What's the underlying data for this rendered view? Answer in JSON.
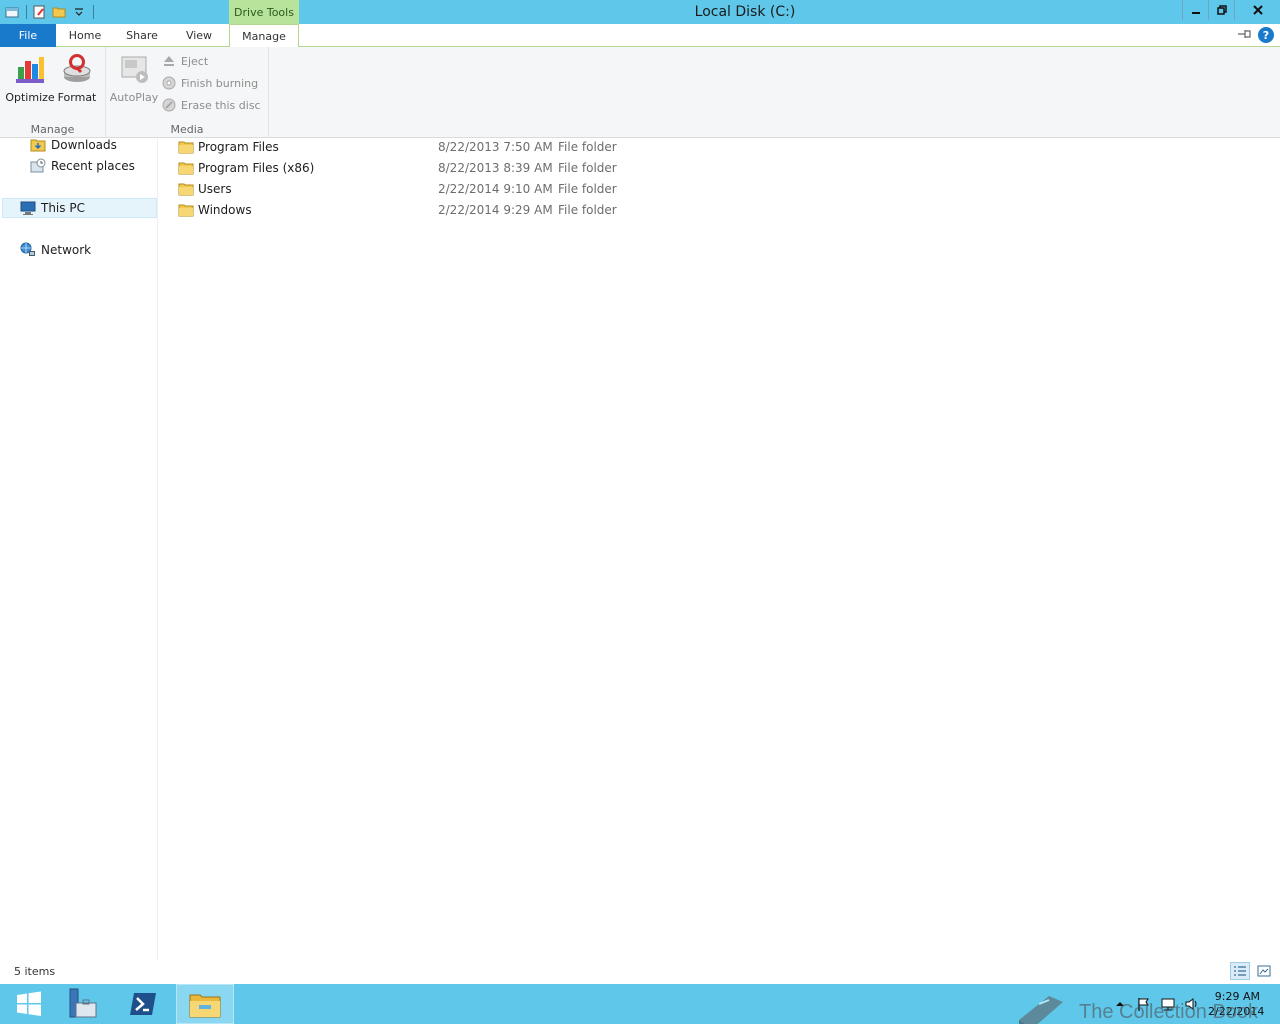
{
  "window": {
    "title": "Local Disk (C:)",
    "context_tab_label": "Drive Tools"
  },
  "tabs": {
    "file": "File",
    "home": "Home",
    "share": "Share",
    "view": "View",
    "manage": "Manage"
  },
  "ribbon": {
    "manage_group": {
      "label": "Manage",
      "optimize": "Optimize",
      "format": "Format"
    },
    "media_group": {
      "label": "Media",
      "autoplay": "AutoPlay",
      "eject": "Eject",
      "finish_burning": "Finish burning",
      "erase_disc": "Erase this disc"
    },
    "help": "?"
  },
  "nav": {
    "downloads": "Downloads",
    "recent_places": "Recent places",
    "this_pc": "This PC",
    "network": "Network"
  },
  "files": [
    {
      "name": "Program Files",
      "date": "8/22/2013 7:50 AM",
      "type": "File folder"
    },
    {
      "name": "Program Files (x86)",
      "date": "8/22/2013 8:39 AM",
      "type": "File folder"
    },
    {
      "name": "Users",
      "date": "2/22/2014 9:10 AM",
      "type": "File folder"
    },
    {
      "name": "Windows",
      "date": "2/22/2014 9:29 AM",
      "type": "File folder"
    }
  ],
  "status": {
    "item_count": "5 items"
  },
  "taskbar": {
    "time": "9:29 AM",
    "date": "2/22/2014"
  },
  "watermark": "The Collection Book",
  "colors": {
    "titlebar": "#5fc7ea",
    "file_tab": "#1979ca",
    "context_tab": "#b7e39b",
    "taskbar": "#5fc7ea"
  }
}
